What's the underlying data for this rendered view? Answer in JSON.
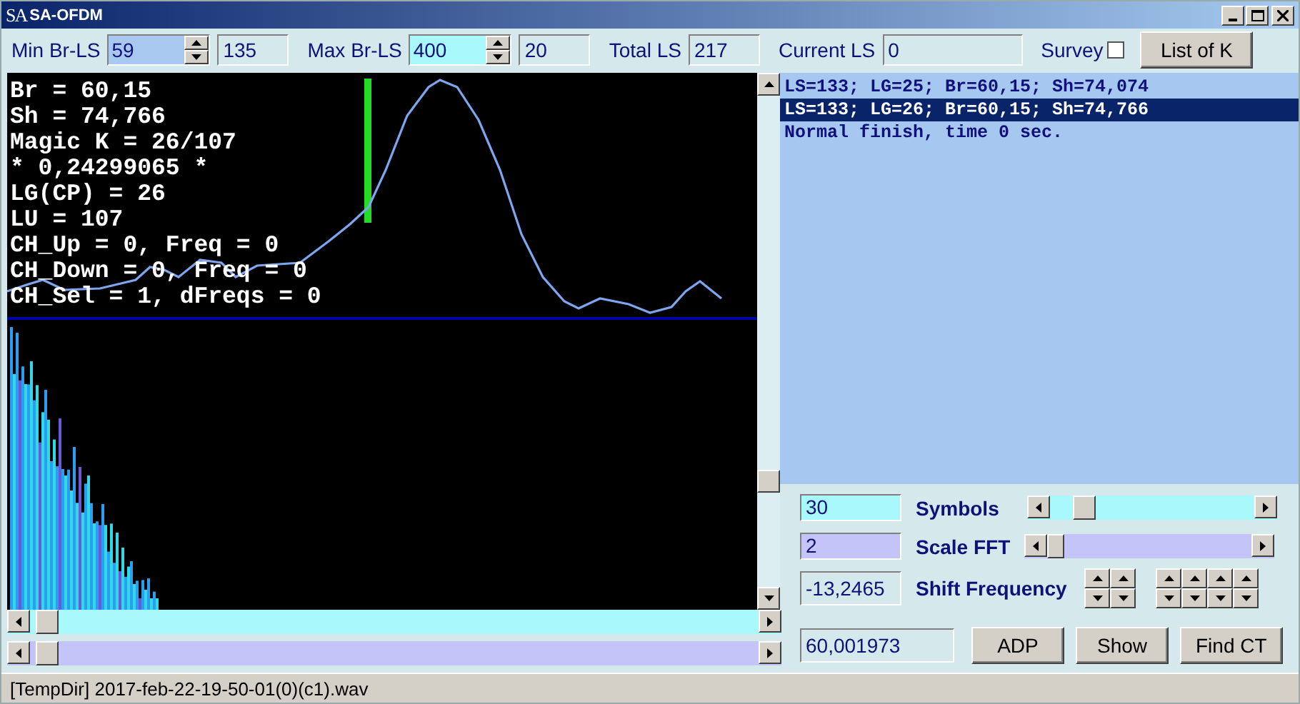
{
  "window": {
    "icon_text": "SA",
    "title": "SA-OFDM"
  },
  "toolbar": {
    "min_br_ls": {
      "label": "Min Br-LS",
      "value": "59",
      "selected": true
    },
    "min_br_ls_extra": "135",
    "max_br_ls": {
      "label": "Max Br-LS",
      "value": "400",
      "selected": false
    },
    "max_br_ls_extra": "20",
    "total_ls": {
      "label": "Total LS",
      "value": "217"
    },
    "current_ls": {
      "label": "Current LS",
      "value": "0"
    },
    "survey": {
      "label": "Survey",
      "checked": false
    },
    "list_button": "List of K"
  },
  "plot": {
    "lines": [
      "Br = 60,15",
      "Sh = 74,766",
      "Magic K = 26/107",
      "* 0,24299065 *",
      "LG(CP) = 26",
      "LU = 107",
      "CH_Up = 0, Freq = 0",
      "CH_Down = 0, Freq = 0",
      "CH_Sel = 1, dFreqs = 0"
    ]
  },
  "log": [
    {
      "text": "LS=133; LG=25; Br=60,15; Sh=74,074",
      "selected": false
    },
    {
      "text": "LS=133; LG=26; Br=60,15; Sh=74,766",
      "selected": true
    },
    {
      "text": "Normal finish, time 0 sec.",
      "selected": false
    }
  ],
  "controls": {
    "symbols": {
      "value": "30",
      "label": "Symbols"
    },
    "scale_fft": {
      "value": "2",
      "label": "Scale FFT"
    },
    "shift_frequency": {
      "value": "-13,2465",
      "label": "Shift Frequency"
    },
    "result": "60,001973",
    "buttons": [
      "ADP",
      "Show",
      "Find CT"
    ]
  },
  "status_bar": "[TempDir] 2017-feb-22-19-50-01(0)(c1).wav"
}
